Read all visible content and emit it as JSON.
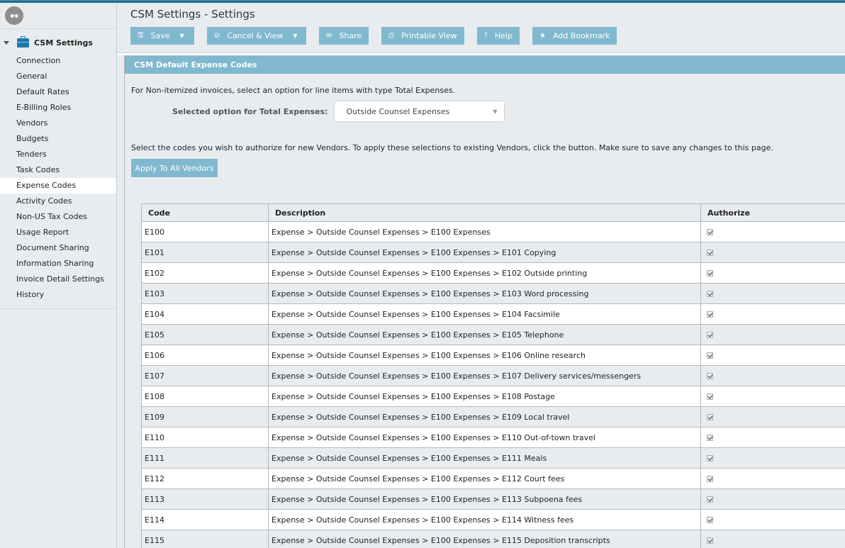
{
  "sidebar": {
    "group_label": "CSM Settings",
    "items": [
      {
        "label": "Connection",
        "active": false
      },
      {
        "label": "General",
        "active": false
      },
      {
        "label": "Default Rates",
        "active": false
      },
      {
        "label": "E-Billing Roles",
        "active": false
      },
      {
        "label": "Vendors",
        "active": false
      },
      {
        "label": "Budgets",
        "active": false
      },
      {
        "label": "Tenders",
        "active": false
      },
      {
        "label": "Task Codes",
        "active": false
      },
      {
        "label": "Expense Codes",
        "active": true
      },
      {
        "label": "Activity Codes",
        "active": false
      },
      {
        "label": "Non-US Tax Codes",
        "active": false
      },
      {
        "label": "Usage Report",
        "active": false
      },
      {
        "label": "Document Sharing",
        "active": false
      },
      {
        "label": "Information Sharing",
        "active": false
      },
      {
        "label": "Invoice Detail Settings",
        "active": false
      },
      {
        "label": "History",
        "active": false
      }
    ]
  },
  "header": {
    "title": "CSM Settings - Settings"
  },
  "toolbar": {
    "save_label": "Save",
    "cancel_label": "Cancel & View",
    "share_label": "Share",
    "print_label": "Printable View",
    "help_label": "Help",
    "bookmark_label": "Add Bookmark"
  },
  "panel": {
    "title": "CSM Default Expense Codes",
    "intro": "For Non-itemized invoices, select an option for line items with type Total Expenses.",
    "option_label": "Selected option for Total Expenses:",
    "option_value": "Outside Counsel Expenses",
    "instructions": "Select the codes you wish to authorize for new Vendors. To apply these selections to existing Vendors, click the button. Make sure to save any changes to this page.",
    "apply_label": "Apply To All Vendors"
  },
  "table": {
    "headers": [
      "Code",
      "Description",
      "Authorize"
    ],
    "rows": [
      {
        "code": "E100",
        "description": "Expense > Outside Counsel Expenses > E100 Expenses",
        "authorized": true
      },
      {
        "code": "E101",
        "description": "Expense > Outside Counsel Expenses > E100 Expenses > E101 Copying",
        "authorized": true
      },
      {
        "code": "E102",
        "description": "Expense > Outside Counsel Expenses > E100 Expenses > E102 Outside printing",
        "authorized": true
      },
      {
        "code": "E103",
        "description": "Expense > Outside Counsel Expenses > E100 Expenses > E103 Word processing",
        "authorized": true
      },
      {
        "code": "E104",
        "description": "Expense > Outside Counsel Expenses > E100 Expenses > E104 Facsimile",
        "authorized": true
      },
      {
        "code": "E105",
        "description": "Expense > Outside Counsel Expenses > E100 Expenses > E105 Telephone",
        "authorized": true
      },
      {
        "code": "E106",
        "description": "Expense > Outside Counsel Expenses > E100 Expenses > E106 Online research",
        "authorized": true
      },
      {
        "code": "E107",
        "description": "Expense > Outside Counsel Expenses > E100 Expenses > E107 Delivery services/messengers",
        "authorized": true
      },
      {
        "code": "E108",
        "description": "Expense > Outside Counsel Expenses > E100 Expenses > E108 Postage",
        "authorized": true
      },
      {
        "code": "E109",
        "description": "Expense > Outside Counsel Expenses > E100 Expenses > E109 Local travel",
        "authorized": true
      },
      {
        "code": "E110",
        "description": "Expense > Outside Counsel Expenses > E100 Expenses > E110 Out-of-town travel",
        "authorized": true
      },
      {
        "code": "E111",
        "description": "Expense > Outside Counsel Expenses > E100 Expenses > E111 Meals",
        "authorized": true
      },
      {
        "code": "E112",
        "description": "Expense > Outside Counsel Expenses > E100 Expenses > E112 Court fees",
        "authorized": true
      },
      {
        "code": "E113",
        "description": "Expense > Outside Counsel Expenses > E100 Expenses > E113 Subpoena fees",
        "authorized": true
      },
      {
        "code": "E114",
        "description": "Expense > Outside Counsel Expenses > E100 Expenses > E114 Witness fees",
        "authorized": true
      },
      {
        "code": "E115",
        "description": "Expense > Outside Counsel Expenses > E100 Expenses > E115 Deposition transcripts",
        "authorized": true
      }
    ]
  },
  "colors": {
    "accent": "#80b8d0",
    "topbar": "#1f6f93",
    "background": "#e9ecef"
  }
}
